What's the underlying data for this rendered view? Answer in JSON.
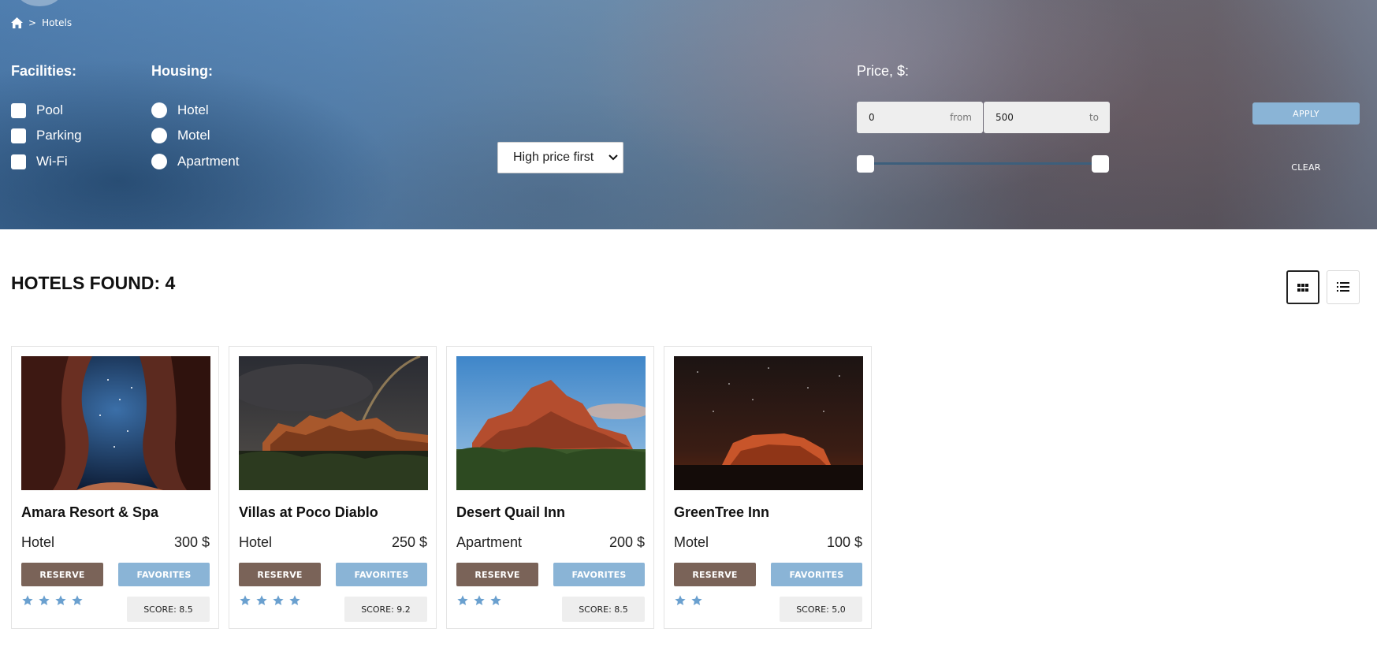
{
  "breadcrumb": {
    "home_icon": "home-icon",
    "separator": ">",
    "current": "Hotels"
  },
  "filters": {
    "facilities_title": "Facilities:",
    "facilities": [
      {
        "label": "Pool",
        "checked": false
      },
      {
        "label": "Parking",
        "checked": false
      },
      {
        "label": "Wi-Fi",
        "checked": false
      }
    ],
    "housing_title": "Housing:",
    "housing": [
      {
        "label": "Hotel",
        "selected": false
      },
      {
        "label": "Motel",
        "selected": false
      },
      {
        "label": "Apartment",
        "selected": false
      }
    ],
    "sort": {
      "selected": "High price first",
      "icon": "chevron-down-icon"
    },
    "price": {
      "title": "Price, $:",
      "from_value": "0",
      "from_suffix": "from",
      "to_value": "500",
      "to_suffix": "to",
      "range_min": 0,
      "range_max": 500
    },
    "apply_label": "APPLY",
    "clear_label": "CLEAR"
  },
  "results": {
    "title": "HOTELS FOUND: 4",
    "grid_view_icon": "grid-icon",
    "list_view_icon": "list-icon",
    "active_view": "grid"
  },
  "hotels": [
    {
      "name": "Amara Resort & Spa",
      "type": "Hotel",
      "price": "300 $",
      "stars": 4,
      "score": "SCORE: 8.5",
      "reserve_label": "RESERVE",
      "favorites_label": "FAVORITES",
      "image": "canyon-cave-night-sky"
    },
    {
      "name": "Villas at Poco Diablo",
      "type": "Hotel",
      "price": "250 $",
      "stars": 4,
      "score": "SCORE: 9.2",
      "reserve_label": "RESERVE",
      "favorites_label": "FAVORITES",
      "image": "red-rocks-rainbow-storm"
    },
    {
      "name": "Desert Quail Inn",
      "type": "Apartment",
      "price": "200 $",
      "stars": 3,
      "score": "SCORE: 8.5",
      "reserve_label": "RESERVE",
      "favorites_label": "FAVORITES",
      "image": "red-butte-blue-sky"
    },
    {
      "name": "GreenTree Inn",
      "type": "Motel",
      "price": "100 $",
      "stars": 2,
      "score": "SCORE: 5,0",
      "reserve_label": "RESERVE",
      "favorites_label": "FAVORITES",
      "image": "glowing-mesa-starry-night"
    }
  ],
  "colors": {
    "reserve": "#7a6358",
    "favorites": "#8ab4d6",
    "star": "#6aa0cf"
  }
}
